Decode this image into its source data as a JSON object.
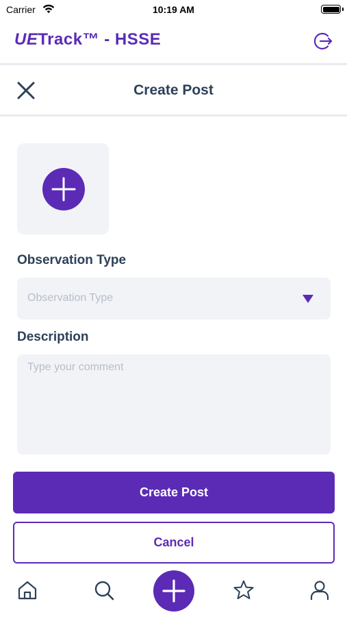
{
  "status_bar": {
    "carrier": "Carrier",
    "time": "10:19 AM"
  },
  "app_header": {
    "title_brand": "UE",
    "title_rest": "Track™ - HSSE",
    "logout_icon": "logout-icon"
  },
  "screen_header": {
    "title": "Create Post",
    "close_icon": "close-icon"
  },
  "form": {
    "media": {
      "add_icon": "plus-icon"
    },
    "observation_type": {
      "label": "Observation Type",
      "placeholder": "Observation Type",
      "selected_value": ""
    },
    "description": {
      "label": "Description",
      "placeholder": "Type your comment",
      "value": ""
    },
    "submit_label": "Create Post",
    "cancel_label": "Cancel"
  },
  "tab_bar": {
    "items": [
      {
        "name": "home",
        "icon": "home-icon"
      },
      {
        "name": "search",
        "icon": "search-icon"
      },
      {
        "name": "add",
        "icon": "plus-icon"
      },
      {
        "name": "favorites",
        "icon": "star-icon"
      },
      {
        "name": "profile",
        "icon": "user-icon"
      }
    ]
  },
  "colors": {
    "accent": "#5b2bb6",
    "text_dark": "#2d4158",
    "field_bg": "#f1f3f7",
    "placeholder": "#b8bec8"
  }
}
